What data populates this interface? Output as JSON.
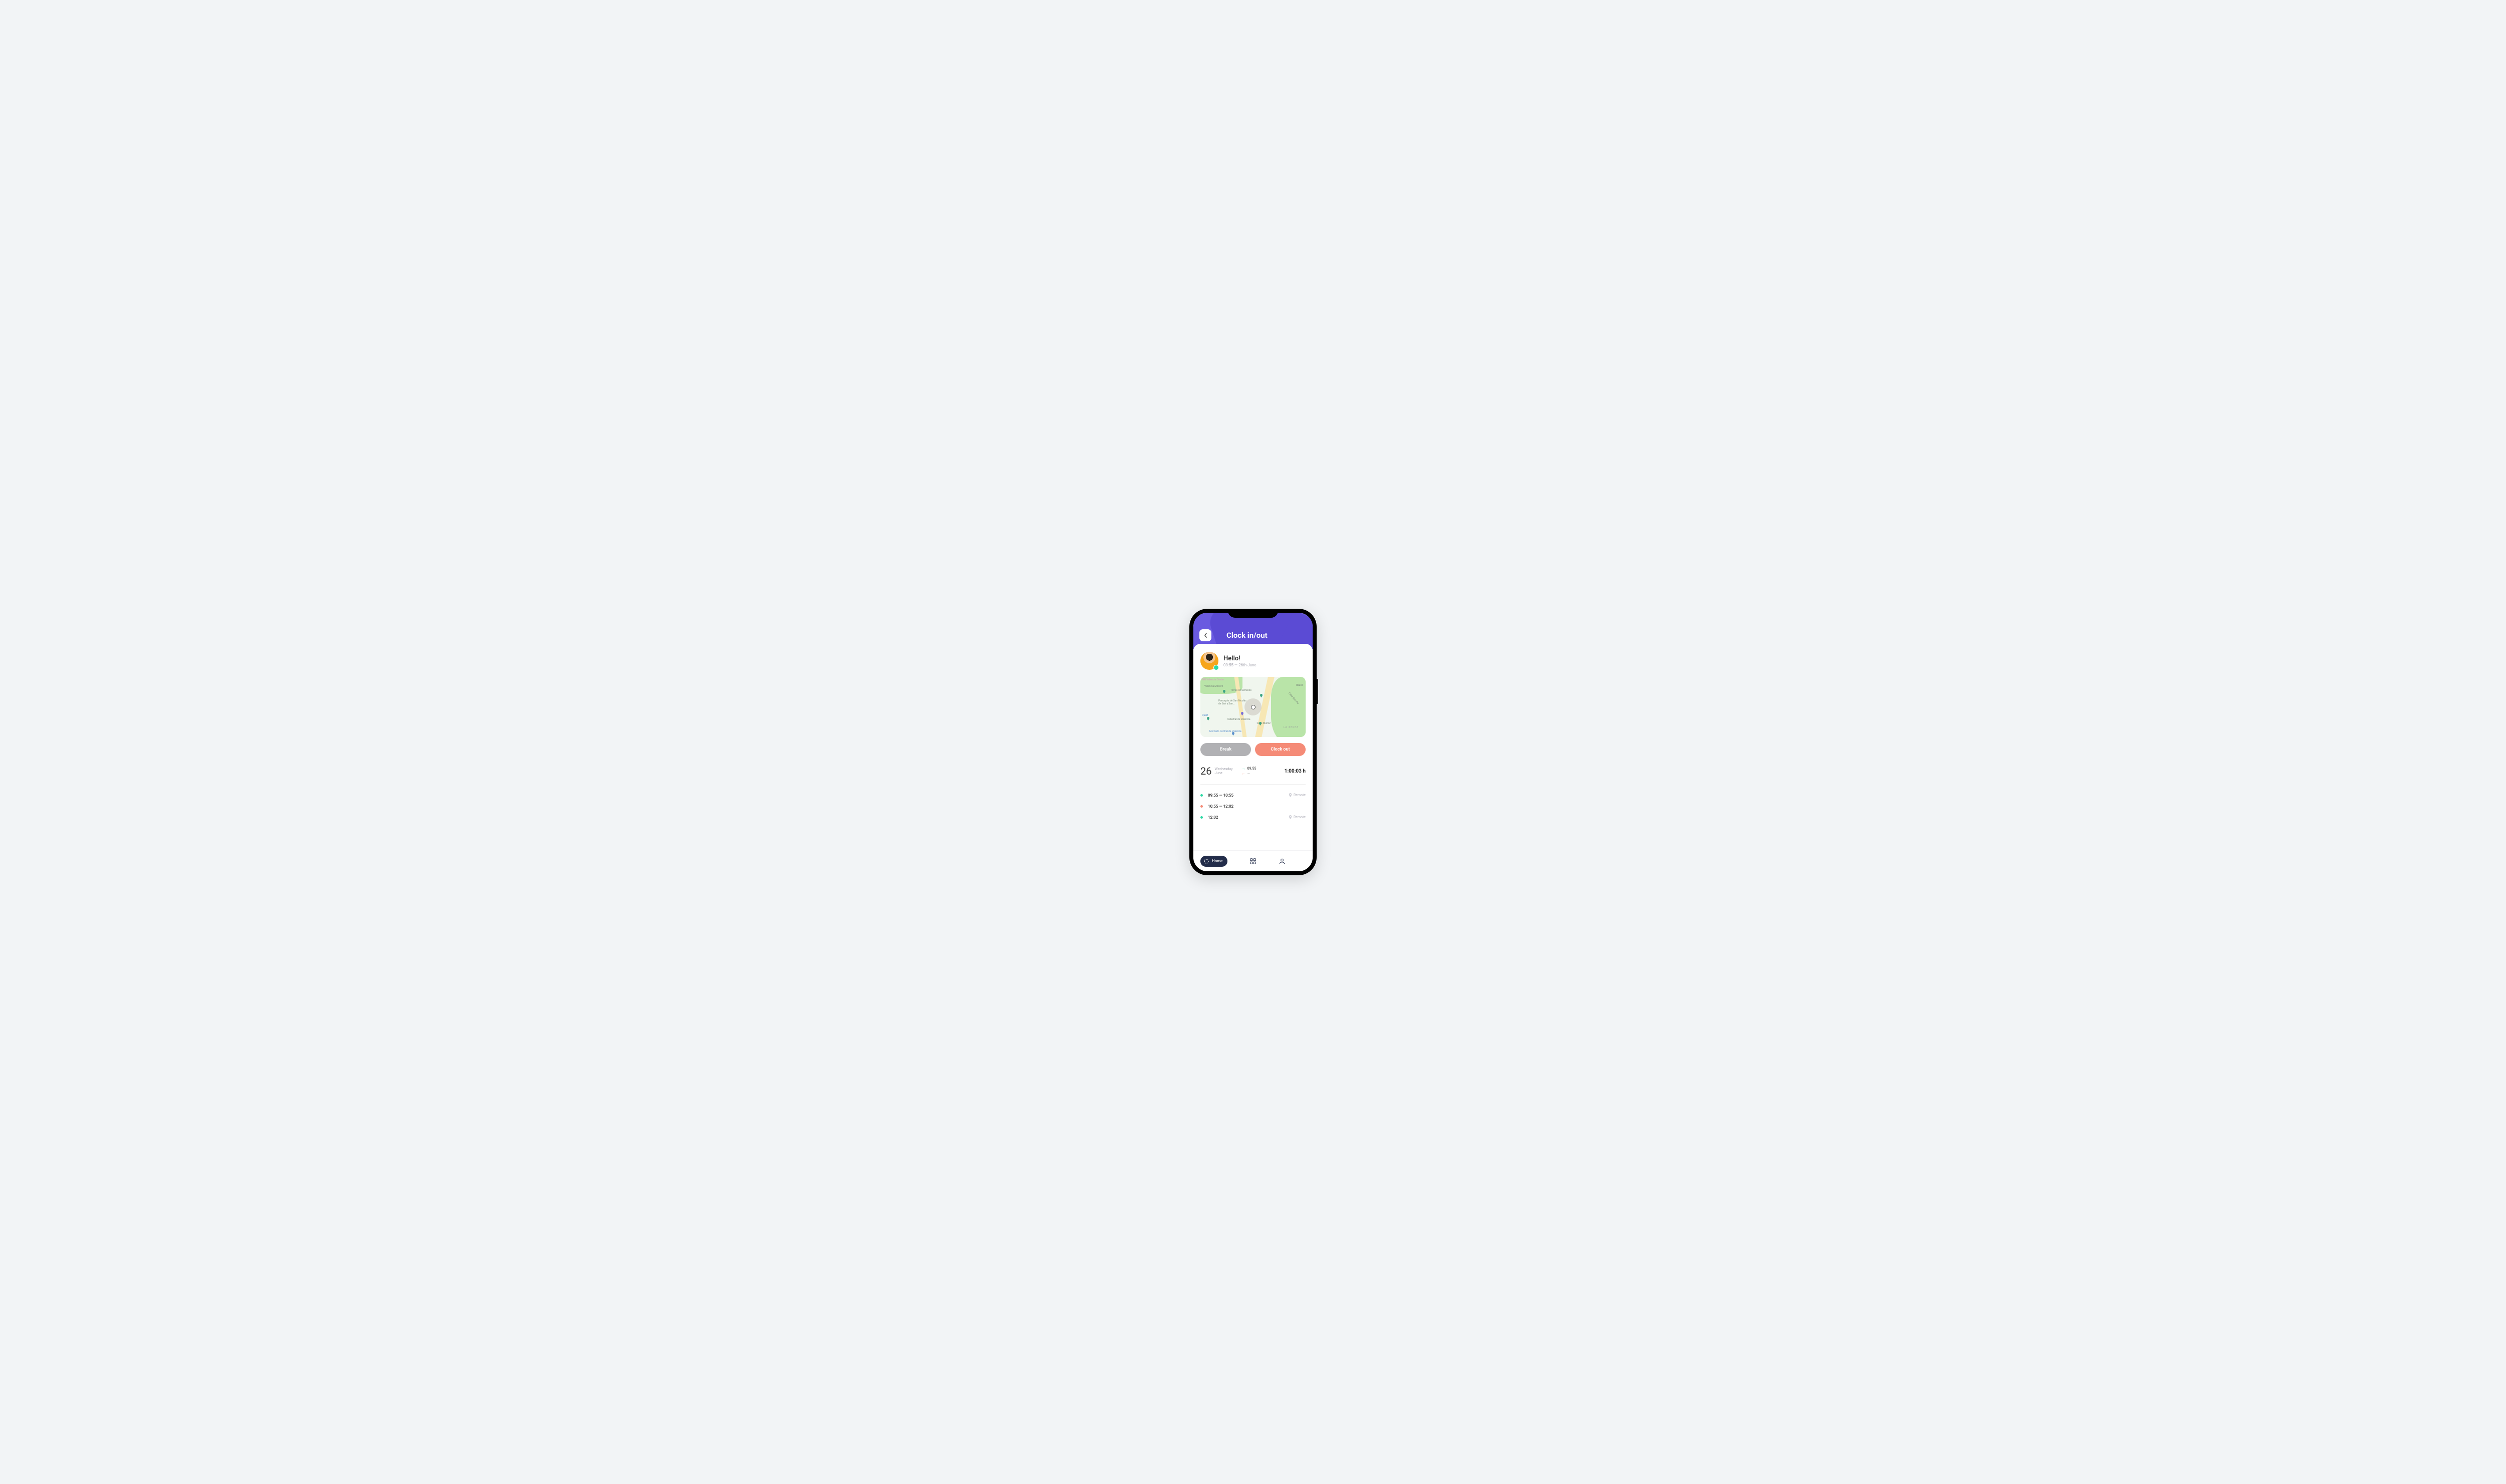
{
  "header": {
    "title": "Clock in/out"
  },
  "greeting": {
    "hello": "Hello!",
    "time": "09:55",
    "sep": "—",
    "date": "26th June"
  },
  "map": {
    "labels": {
      "nh": "NH Valencia Center",
      "modern": "Valencia Modern",
      "torres": "Torres de Serranos",
      "parroquia": "Parroquia de San Nicolás de Bari y San...",
      "catedral": "Catedral de Valencia",
      "mercado": "Mercado Central de Valencia",
      "quart": "Quart",
      "reard": "Reard",
      "xerea": "LA XEREA",
      "munoz": "Calle Muñoz",
      "sanpio": "Calle San Pío"
    }
  },
  "actions": {
    "break": "Break",
    "clockout": "Clock out"
  },
  "summary": {
    "day": "26",
    "weekday": "Wednesday",
    "month": "June",
    "in": "09.55",
    "out": "—",
    "total": "1:00:03 h"
  },
  "log": [
    {
      "color": "green",
      "range": "09:55 — 10:55",
      "loc": "Remote"
    },
    {
      "color": "coral",
      "range": "10:55 — 12:02",
      "loc": ""
    },
    {
      "color": "green",
      "range": "12:02",
      "loc": "Remote"
    }
  ],
  "tabs": {
    "home": "Home"
  }
}
